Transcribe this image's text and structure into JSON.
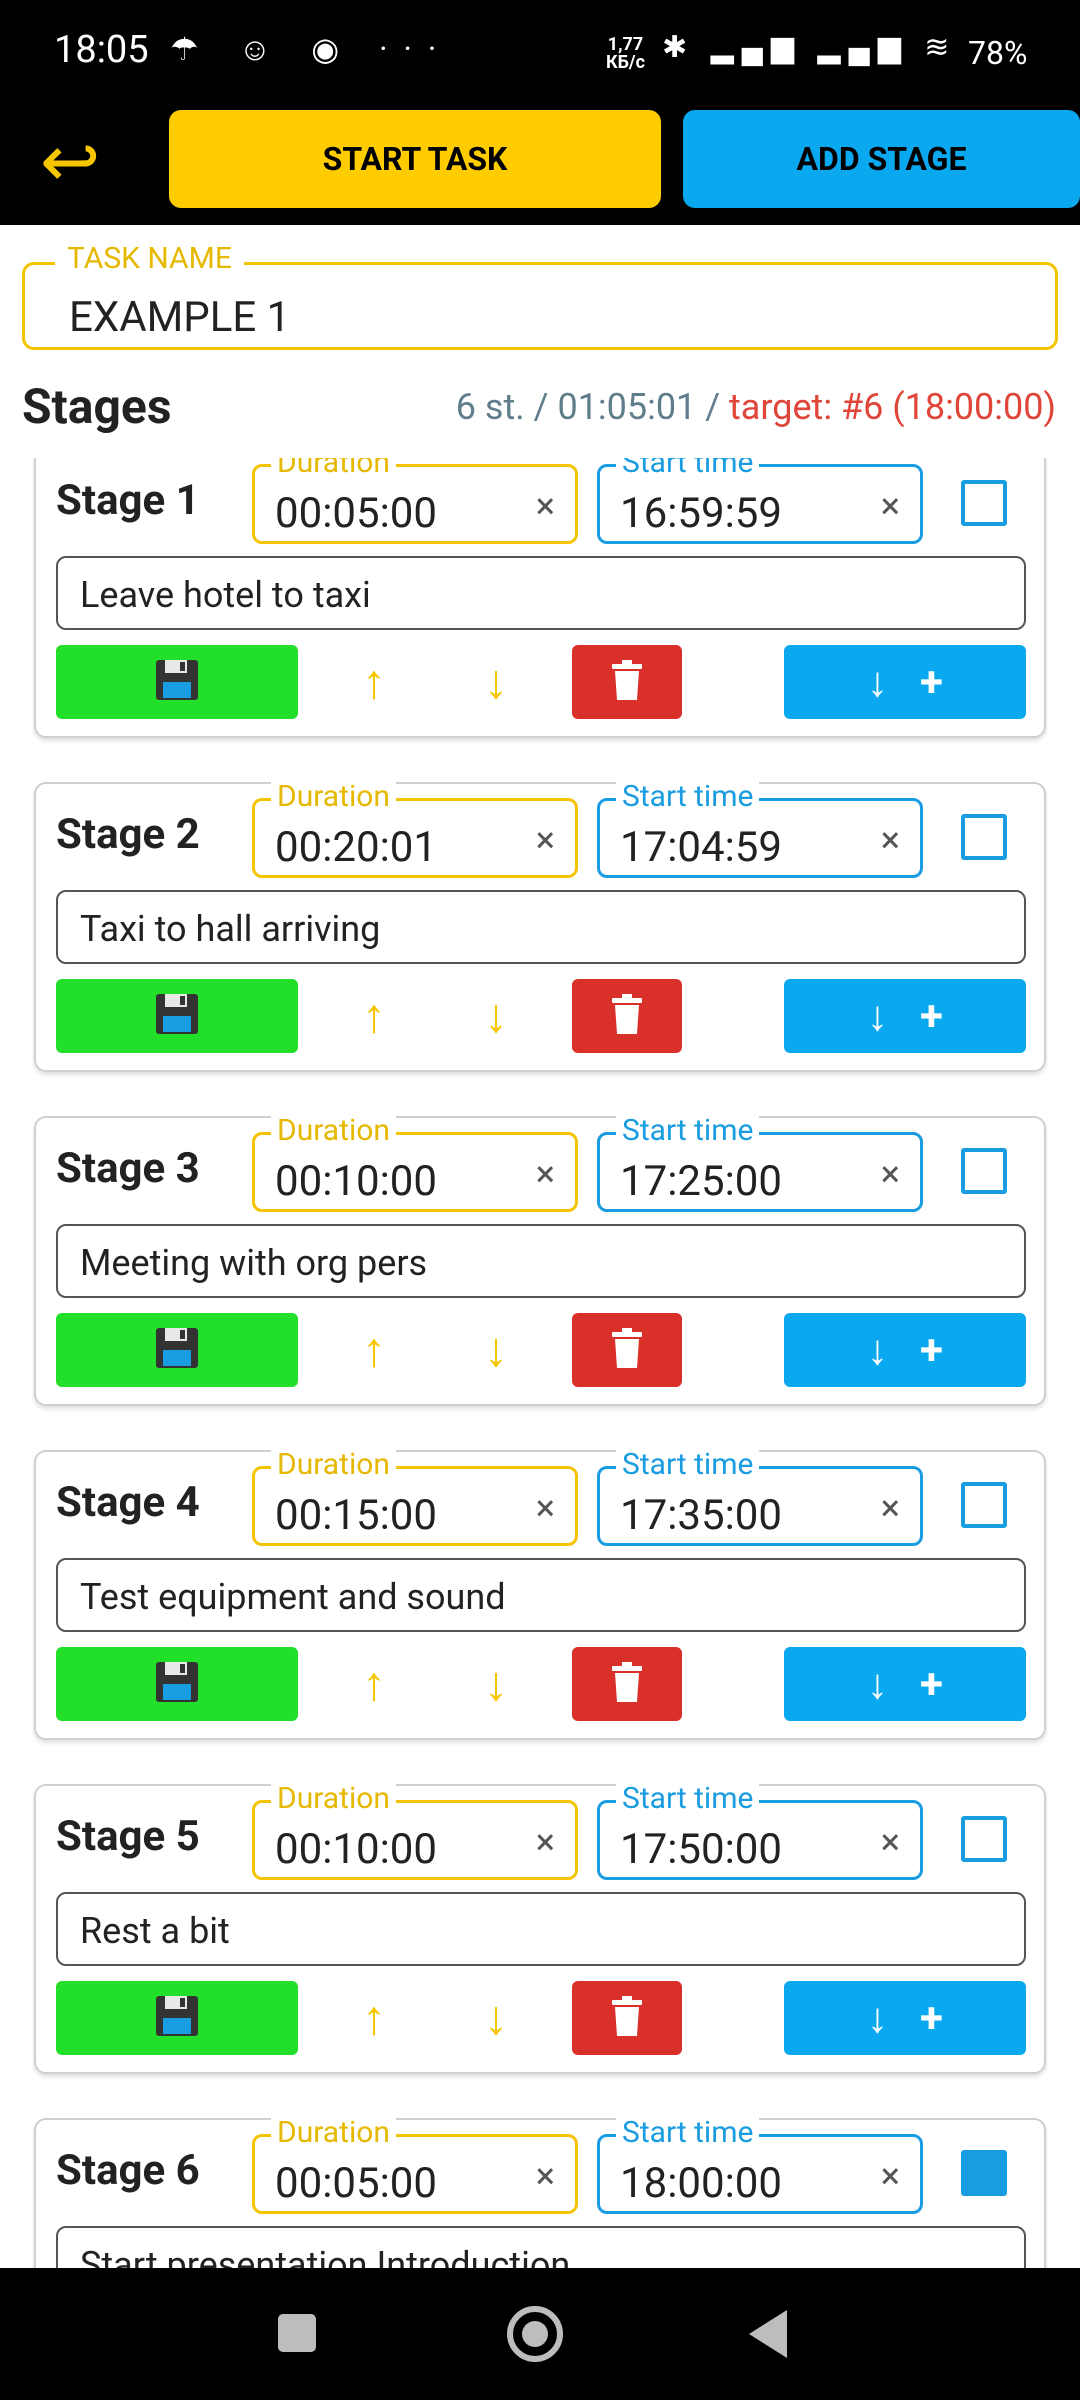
{
  "status_bar": {
    "time": "18:05",
    "notifications": "☂ ☺ ◉ ···",
    "net_speed_value": "1,77",
    "net_speed_unit": "КБ/с",
    "signal_icons": "✱ ▂▄▆ ▂▄▆ ≋",
    "battery": "78%"
  },
  "app_bar": {
    "back_icon": "↩",
    "start_task_label": "START TASK",
    "add_stage_label": "ADD STAGE"
  },
  "task": {
    "label": "TASK NAME",
    "value": "EXAMPLE 1"
  },
  "stages_header": {
    "title": "Stages",
    "summary": "6 st. / 01:05:01 / ",
    "target": "target: #6 (18:00:00)"
  },
  "stage_field_labels": {
    "duration": "Duration",
    "start_time": "Start time",
    "clear": "×"
  },
  "stages": [
    {
      "title": "Stage 1",
      "duration": "00:05:00",
      "start": "16:59:59",
      "description": "Leave hotel to taxi",
      "checked": false
    },
    {
      "title": "Stage 2",
      "duration": "00:20:01",
      "start": "17:04:59",
      "description": "Taxi to hall arriving",
      "checked": false
    },
    {
      "title": "Stage 3",
      "duration": "00:10:00",
      "start": "17:25:00",
      "description": "Meeting with org pers",
      "checked": false
    },
    {
      "title": "Stage 4",
      "duration": "00:15:00",
      "start": "17:35:00",
      "description": "Test equipment and sound",
      "checked": false
    },
    {
      "title": "Stage 5",
      "duration": "00:10:00",
      "start": "17:50:00",
      "description": "Rest a bit",
      "checked": false
    },
    {
      "title": "Stage 6",
      "duration": "00:05:00",
      "start": "18:00:00",
      "description": "Start presentation Introduction",
      "checked": true
    }
  ],
  "stage_buttons": {
    "up": "↑",
    "down": "↓",
    "insert_arrow": "↓",
    "insert_plus": "+"
  },
  "colors": {
    "accent_yellow": "#ffcc00",
    "accent_blue": "#0aa8ee",
    "save_green": "#22e02a",
    "delete_red": "#d9302a",
    "target_red": "#e0453a"
  }
}
